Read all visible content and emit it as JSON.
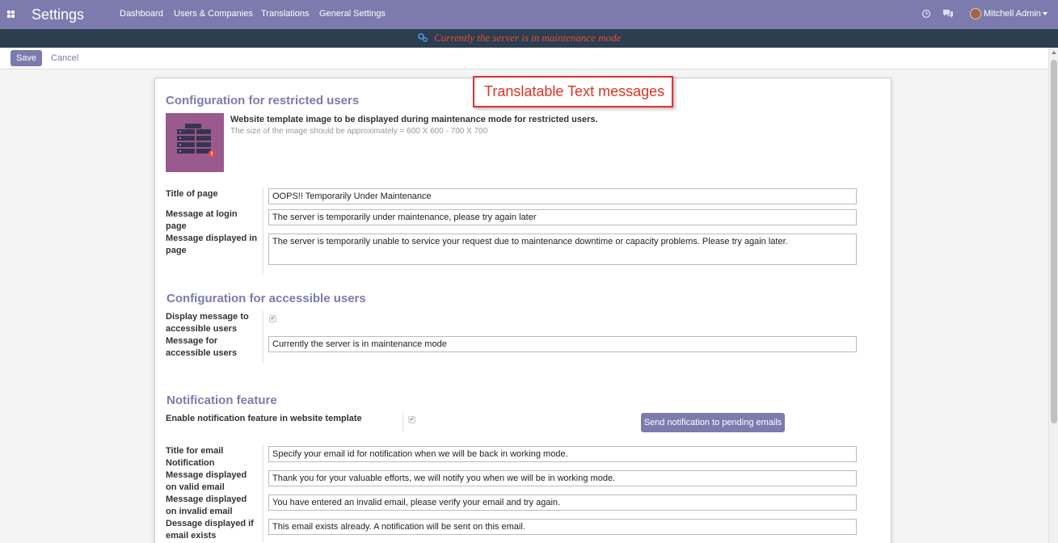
{
  "topbar": {
    "brand": "Settings",
    "menu": [
      "Dashboard",
      "Users & Companies",
      "Translations",
      "General Settings"
    ],
    "user_name": "Mitchell Admin"
  },
  "maintenance_banner": "Currently the server is in maintenance mode",
  "controls": {
    "save": "Save",
    "cancel": "Cancel"
  },
  "callout": "Translatable Text messages",
  "restricted": {
    "title": "Configuration for restricted users",
    "image_caption": "Website template image to be displayed during maintenance mode for restricted users.",
    "image_hint": "The size of the image should be approximately = 600 X 600 - 700 X 700",
    "fields": [
      {
        "label": "Title of page",
        "value": "OOPS!! Temporarily Under Maintenance"
      },
      {
        "label": "Message at login page",
        "value": "The server is temporarily under maintenance, please try again later"
      },
      {
        "label": "Message displayed in page",
        "value": "The server is temporarily unable to service your request due to maintenance downtime or capacity problems. Please try again later."
      }
    ]
  },
  "accessible": {
    "title": "Configuration for accessible users",
    "display_label": "Display message to accessible users",
    "display_checked": true,
    "message_label": "Message for accessible users",
    "message_value": "Currently the server is in maintenance mode"
  },
  "notification": {
    "title": "Notification feature",
    "enable_label": "Enable notification feature in website template",
    "enable_checked": true,
    "send_button": "Send notification to pending emails",
    "fields": [
      {
        "label": "Title for email Notification",
        "value": "Specify your email id for notification when we will be back in working mode."
      },
      {
        "label": "Message displayed on valid email",
        "value": "Thank you for your valuable efforts, we will notify you when we will be in working mode."
      },
      {
        "label": "Message displayed on invalid email",
        "value": "You have entered an invalid email, please verify your email and try again."
      },
      {
        "label": "Dessage displayed if email exists",
        "value": "This email exists already. A notification will be sent on this email."
      }
    ]
  },
  "colors": {
    "brand": "#7c7bad",
    "banner_bg": "#2c3e50",
    "banner_text": "#e74c3c",
    "callout_border": "#dd3333"
  }
}
